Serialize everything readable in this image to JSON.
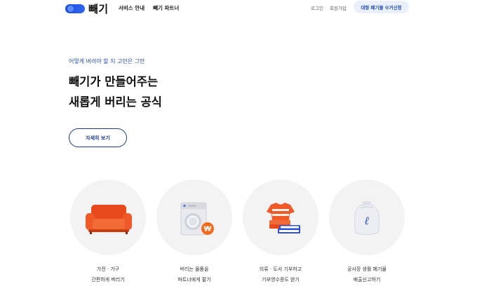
{
  "header": {
    "logo_text": "빼기",
    "nav": [
      "서비스 안내",
      "빼기 파트너"
    ],
    "auth": [
      "로그인",
      "회원가입"
    ],
    "cta": "대형 폐기물 수거신청"
  },
  "hero": {
    "eyebrow": "어떻게 버려야 할 지 고민은 그만",
    "title_line1": "빼기가 만들어주는",
    "title_line2": "새롭게 버리는 공식",
    "more_button": "자세히 보기"
  },
  "services": [
    {
      "icon": "sofa-icon",
      "line1": "가전 · 가구",
      "line2": "간편하게 버리기"
    },
    {
      "icon": "washing-machine-icon",
      "line1": "버리는 물품을",
      "line2": "파트너에게 팔기"
    },
    {
      "icon": "clothes-books-icon",
      "line1": "의류 · 도서 기부하고",
      "line2": "기부영수증도 받기"
    },
    {
      "icon": "waste-bag-icon",
      "line1": "공사장 생활 폐기물",
      "line2": "배출신고하기"
    }
  ],
  "colors": {
    "brand": "#2f66f2",
    "accent_text": "#2c4fb8",
    "sofa": "#f05a28",
    "circle_bg": "#f3f3f3"
  }
}
